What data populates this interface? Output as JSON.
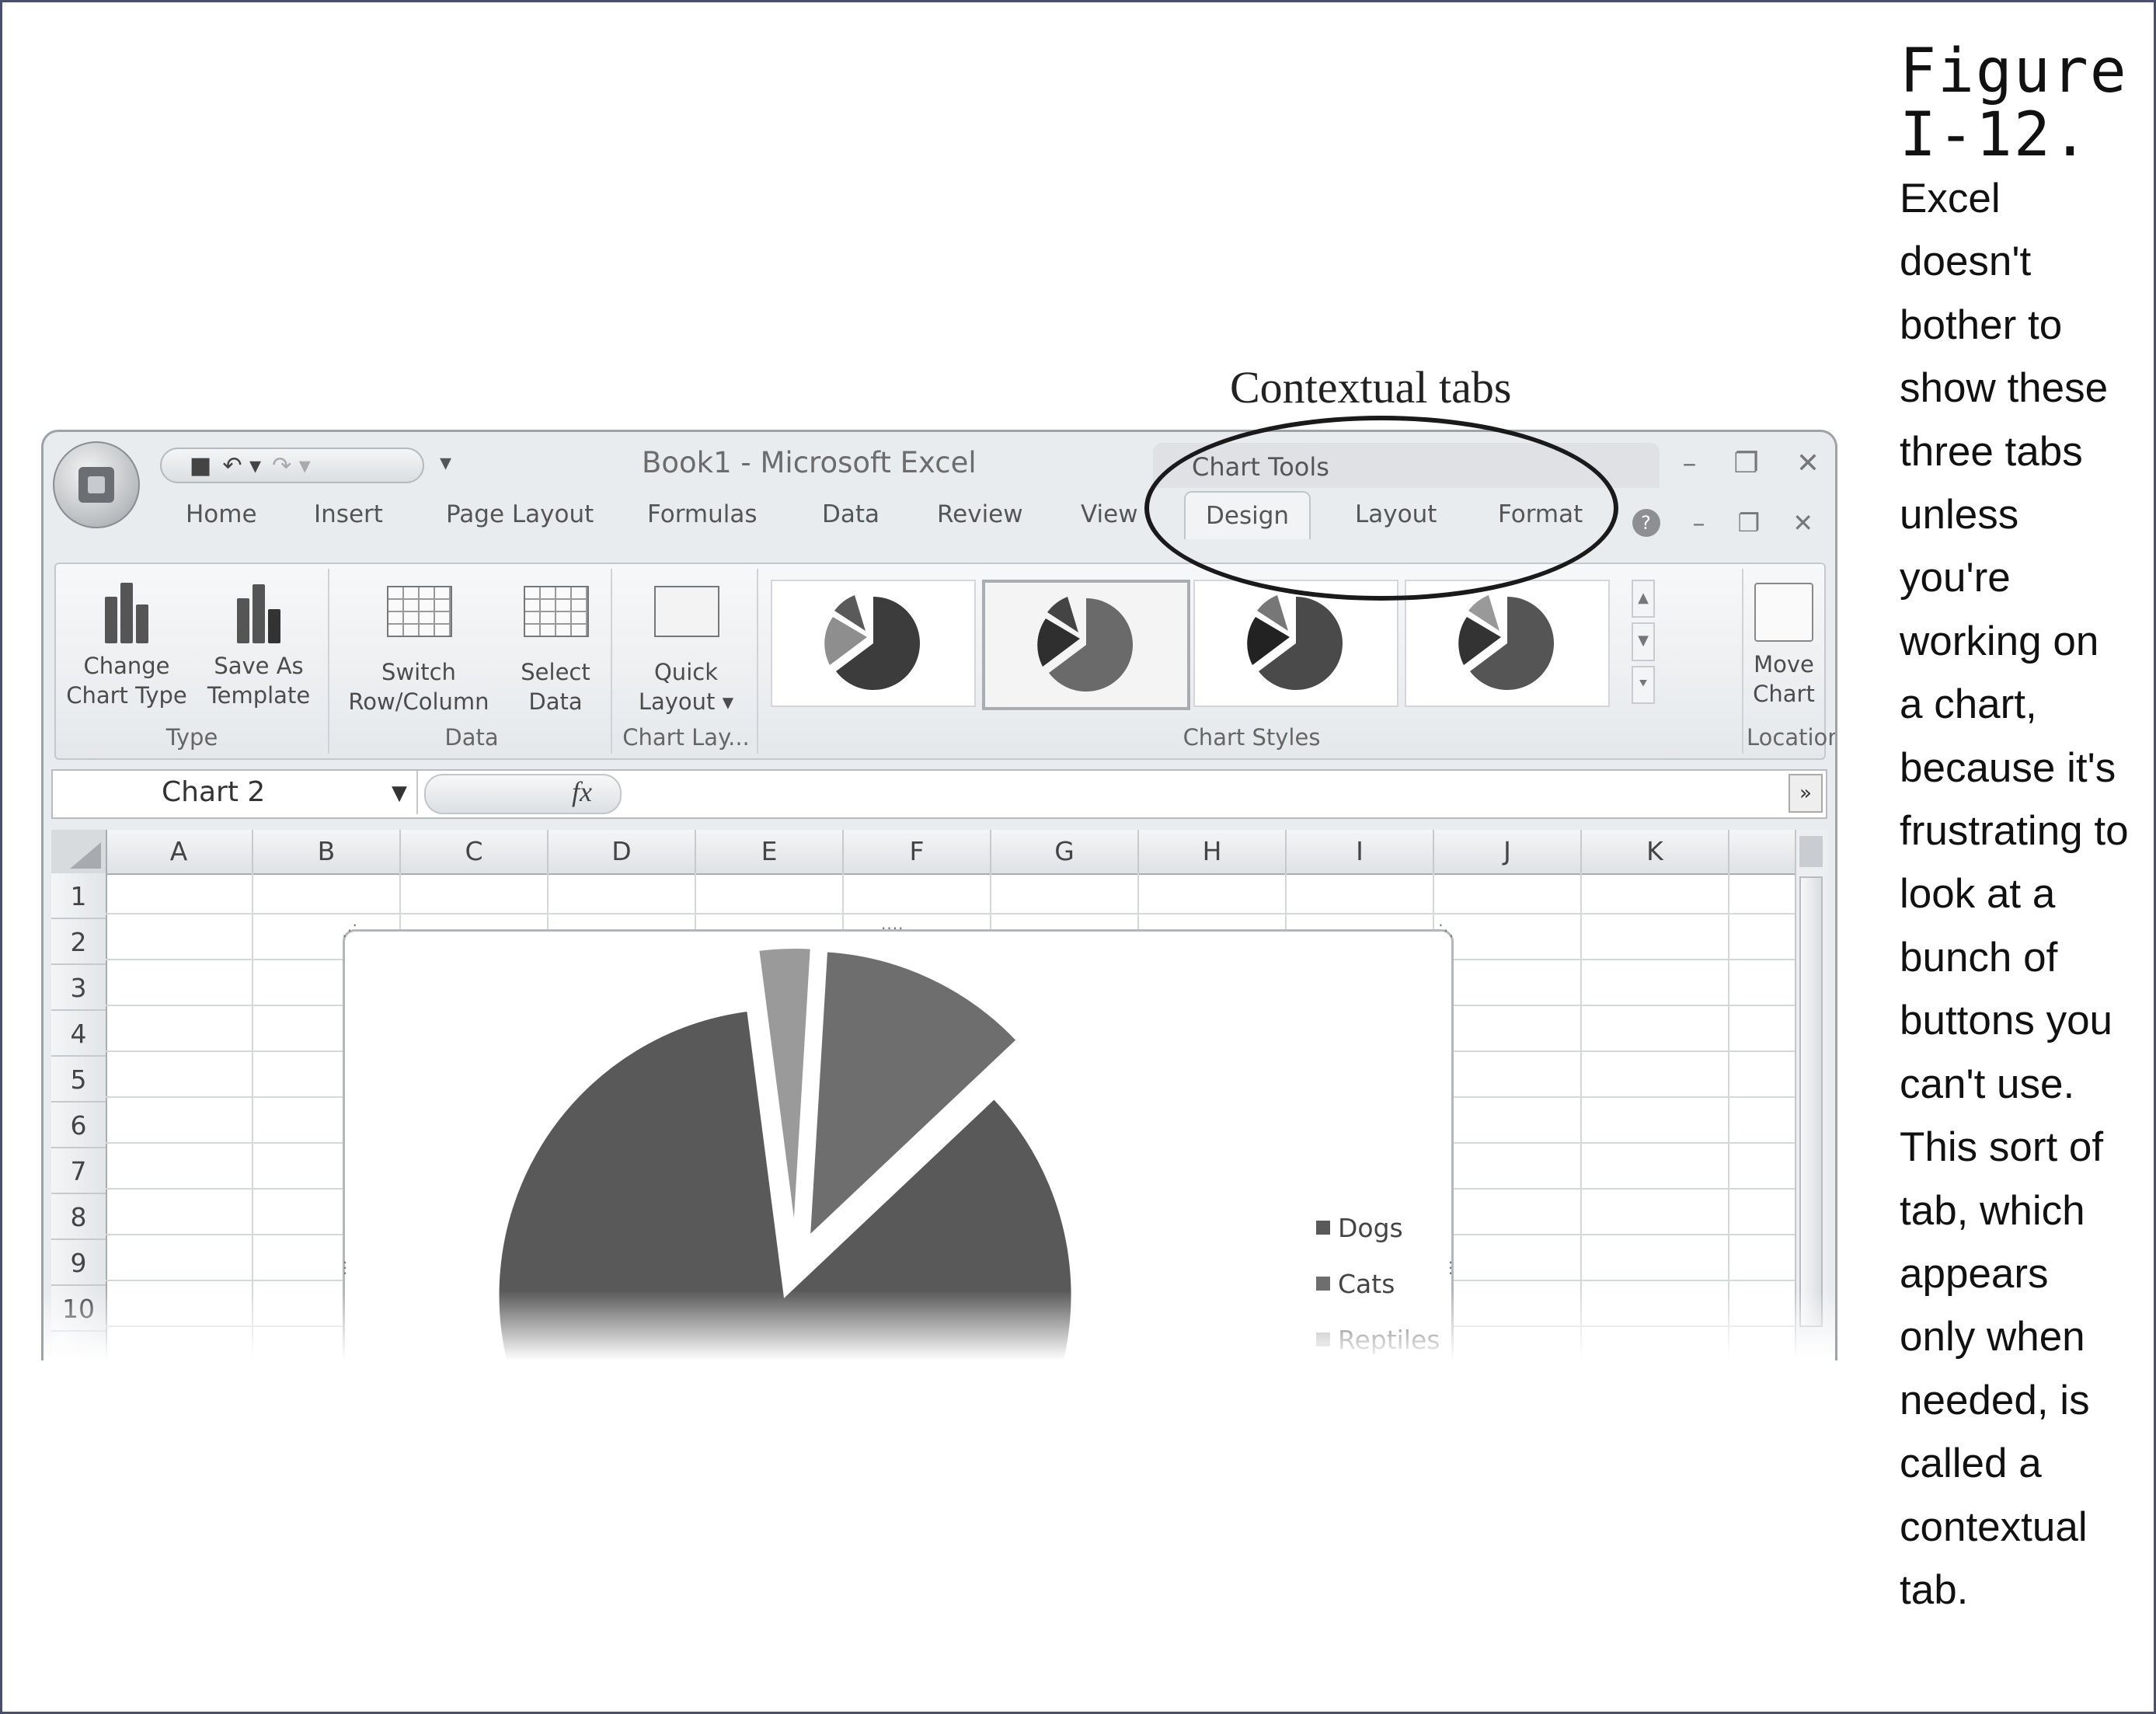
{
  "figure": {
    "label": "Figure I-12.",
    "caption": "Excel doesn't bother to show these three tabs unless you're working on a chart, because it's frustrating to look at a bunch of buttons you can't use. This sort of tab, which appears only when needed, is called a contextual tab.",
    "callout": "Contextual tabs"
  },
  "window": {
    "title": "Book1 - Microsoft Excel",
    "contextual_group": "Chart Tools",
    "controls": [
      "–",
      "❐",
      "✕"
    ],
    "doc_controls": [
      "–",
      "❐",
      "✕"
    ]
  },
  "quick_access": {
    "items": [
      "save-icon",
      "undo-icon",
      "redo-icon"
    ],
    "more": "▾"
  },
  "tabs": {
    "main": [
      "Home",
      "Insert",
      "Page Layout",
      "Formulas",
      "Data",
      "Review",
      "View"
    ],
    "contextual": [
      "Design",
      "Layout",
      "Format"
    ],
    "active": "Design"
  },
  "ribbon": {
    "groups": [
      {
        "label": "Type",
        "buttons": [
          {
            "label": "Change Chart Type"
          },
          {
            "label": "Save As Template"
          }
        ]
      },
      {
        "label": "Data",
        "buttons": [
          {
            "label": "Switch Row/Column"
          },
          {
            "label": "Select Data"
          }
        ]
      },
      {
        "label": "Chart Lay...",
        "buttons": [
          {
            "label": "Quick Layout ▾"
          }
        ]
      },
      {
        "label": "Chart Styles",
        "selected_style": 2
      },
      {
        "label": "Location",
        "buttons": [
          {
            "label": "Move Chart"
          }
        ]
      }
    ]
  },
  "formula_bar": {
    "name_box": "Chart 2",
    "fx": "fx",
    "formula": ""
  },
  "sheet": {
    "columns": [
      "A",
      "B",
      "C",
      "D",
      "E",
      "F",
      "G",
      "H",
      "I",
      "J",
      "K"
    ],
    "rows": [
      "1",
      "2",
      "3",
      "4",
      "5",
      "6",
      "7",
      "8",
      "9",
      "10"
    ]
  },
  "chart_data": {
    "type": "pie",
    "labels": [
      "Dogs",
      "Cats",
      "Reptiles"
    ],
    "values": [
      85,
      12,
      3
    ],
    "exploded": true,
    "legend_position": "right",
    "colors": [
      "#595959",
      "#6e6e6e",
      "#9a9a9a"
    ]
  }
}
